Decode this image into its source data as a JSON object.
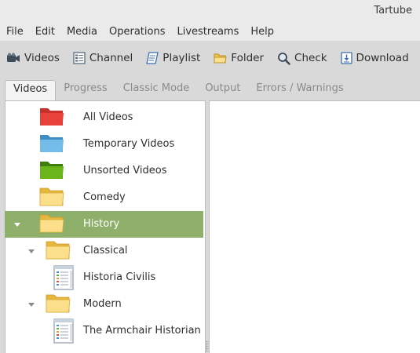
{
  "window": {
    "title": "Tartube"
  },
  "menubar": {
    "items": [
      "File",
      "Edit",
      "Media",
      "Operations",
      "Livestreams",
      "Help"
    ]
  },
  "toolbar": {
    "buttons": [
      {
        "label": "Videos",
        "icon": "video-camera-icon"
      },
      {
        "label": "Channel",
        "icon": "channel-icon"
      },
      {
        "label": "Playlist",
        "icon": "playlist-icon"
      },
      {
        "label": "Folder",
        "icon": "folder-icon"
      },
      {
        "label": "Check",
        "icon": "check-icon"
      },
      {
        "label": "Download",
        "icon": "download-icon"
      }
    ]
  },
  "tabs": [
    "Videos",
    "Progress",
    "Classic Mode",
    "Output",
    "Errors / Warnings"
  ],
  "tree": {
    "items": [
      {
        "label": "All Videos",
        "icon": "red-folder-icon",
        "color": "#e8413a"
      },
      {
        "label": "Temporary Videos",
        "icon": "blue-folder-icon",
        "color": "#5aaee0"
      },
      {
        "label": "Unsorted Videos",
        "icon": "green-folder-icon",
        "color": "#5fae14"
      },
      {
        "label": "Comedy",
        "icon": "yellow-folder-icon",
        "color": "#f7d36a"
      },
      {
        "label": "History",
        "icon": "yellow-folder-icon",
        "color": "#f7d36a",
        "selected": true,
        "expanded": true
      },
      {
        "label": "Classical",
        "icon": "yellow-folder-icon",
        "color": "#f7d36a",
        "expanded": true
      },
      {
        "label": "Historia Civilis",
        "icon": "channel-list-icon"
      },
      {
        "label": "Modern",
        "icon": "yellow-folder-icon",
        "color": "#f7d36a",
        "expanded": true
      },
      {
        "label": "The Armchair Historian",
        "icon": "channel-list-icon"
      }
    ]
  },
  "colors": {
    "selection": "#8fb06b",
    "toolbar": "#d9d9d9",
    "pane": "#ffffff"
  }
}
